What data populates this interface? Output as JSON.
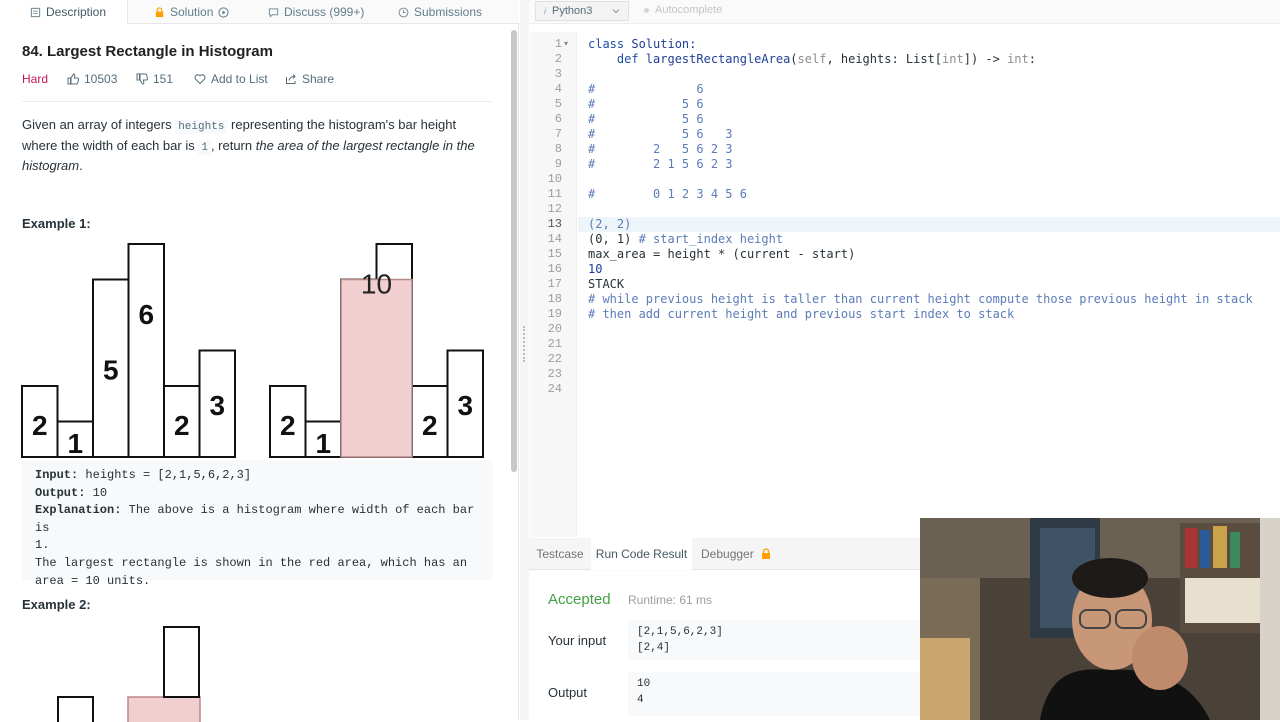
{
  "tabs": {
    "description": "Description",
    "solution": "Solution",
    "discuss": "Discuss (999+)",
    "submissions": "Submissions"
  },
  "problem": {
    "title": "84. Largest Rectangle in Histogram",
    "difficulty": "Hard",
    "difficulty_color": "#c2185b",
    "likes": "10503",
    "dislikes": "151",
    "add_to_list": "Add to List",
    "share": "Share",
    "para_1": "Given an array of integers ",
    "para_code_1": "heights",
    "para_2": " representing the histogram's bar height where the width of each bar is ",
    "para_code_2": "1",
    "para_3": ", return ",
    "para_italic": "the area of the largest rectangle in the histogram",
    "para_4": "."
  },
  "example1": {
    "heading": "Example 1:",
    "bars": [
      2,
      1,
      5,
      6,
      2,
      3
    ],
    "highlight_area": "10",
    "input_label": "Input:",
    "input_value": " heights = [2,1,5,6,2,3]",
    "output_label": "Output:",
    "output_value": " 10",
    "explanation_label": "Explanation:",
    "explanation_value": " The above is a histogram where width of each bar is",
    "explanation_line2": "1.",
    "explanation_line3": "The largest rectangle is shown in the red area, which has an",
    "explanation_line4": "area = 10 units."
  },
  "example2": {
    "heading": "Example 2:"
  },
  "editor": {
    "language": "Python3",
    "autocomplete": "Autocomplete",
    "line_numbers": [
      "1",
      "2",
      "3",
      "4",
      "5",
      "6",
      "7",
      "8",
      "9",
      "10",
      "11",
      "12",
      "13",
      "14",
      "15",
      "16",
      "17",
      "18",
      "19",
      "20",
      "21",
      "22",
      "23",
      "24"
    ],
    "line1_kw": "class",
    "line1_name": " Solution:",
    "line2_def": "    def ",
    "line2_fn": "largestRectangleArea",
    "line2_open": "(",
    "line2_self": "self",
    "line2_mid": ", heights: List[",
    "line2_int1": "int",
    "line2_close": "]) -> ",
    "line2_int2": "int",
    "line2_colon": ":",
    "comment_lines": [
      "#              6",
      "#            5 6",
      "#            5 6",
      "#            5 6   3",
      "#        2   5 6 2 3",
      "#        2 1 5 6 2 3",
      "",
      "#        0 1 2 3 4 5 6"
    ],
    "line13": "(2, 2)",
    "line14_code": "(0, 1) ",
    "line14_comment": "# start_index height",
    "line15": "max_area = height * (current - start)",
    "line16": "10",
    "line17": "STACK",
    "line18": "# while previous height is taller than current height compute those previous height in stack",
    "line19": "# then add current height and previous start index to stack"
  },
  "bottom": {
    "tab_testcase": "Testcase",
    "tab_run": "Run Code Result",
    "tab_debugger": "Debugger",
    "status": "Accepted",
    "runtime": "Runtime: 61 ms",
    "your_input_label": "Your input",
    "your_input": "[2,1,5,6,2,3]\n[2,4]",
    "output_label": "Output",
    "output": "10\n4"
  }
}
